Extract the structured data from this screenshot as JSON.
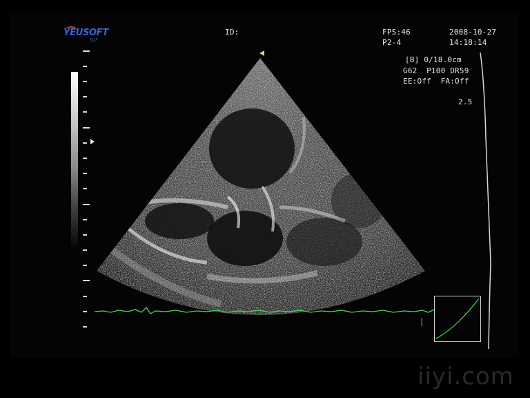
{
  "header": {
    "logo_text": "YEUSOFT",
    "logo_sub": "SUF",
    "id_label": "ID:",
    "fps": "FPS:46",
    "probe": "P2-4",
    "date": "2008-10-27",
    "time": "14:18:14"
  },
  "params": {
    "mode_depth": "[B] 0/18.0cm",
    "gain_line": "G62  P100 DR59",
    "ee_fa": "EE:Off  FA:Off",
    "focus_value": "2.5"
  },
  "watermark": "iiyi.com",
  "colors": {
    "ecg_trace": "#3fe04a",
    "logo_blue": "#3a63d8",
    "logo_arc": "#d23a2a",
    "probe_marker": "#e7d37a",
    "depth_marker": "#e8e8e8"
  },
  "icons": {
    "probe_orientation": "triangle-marker-icon",
    "focus_position": "triangle-pointer-icon"
  }
}
